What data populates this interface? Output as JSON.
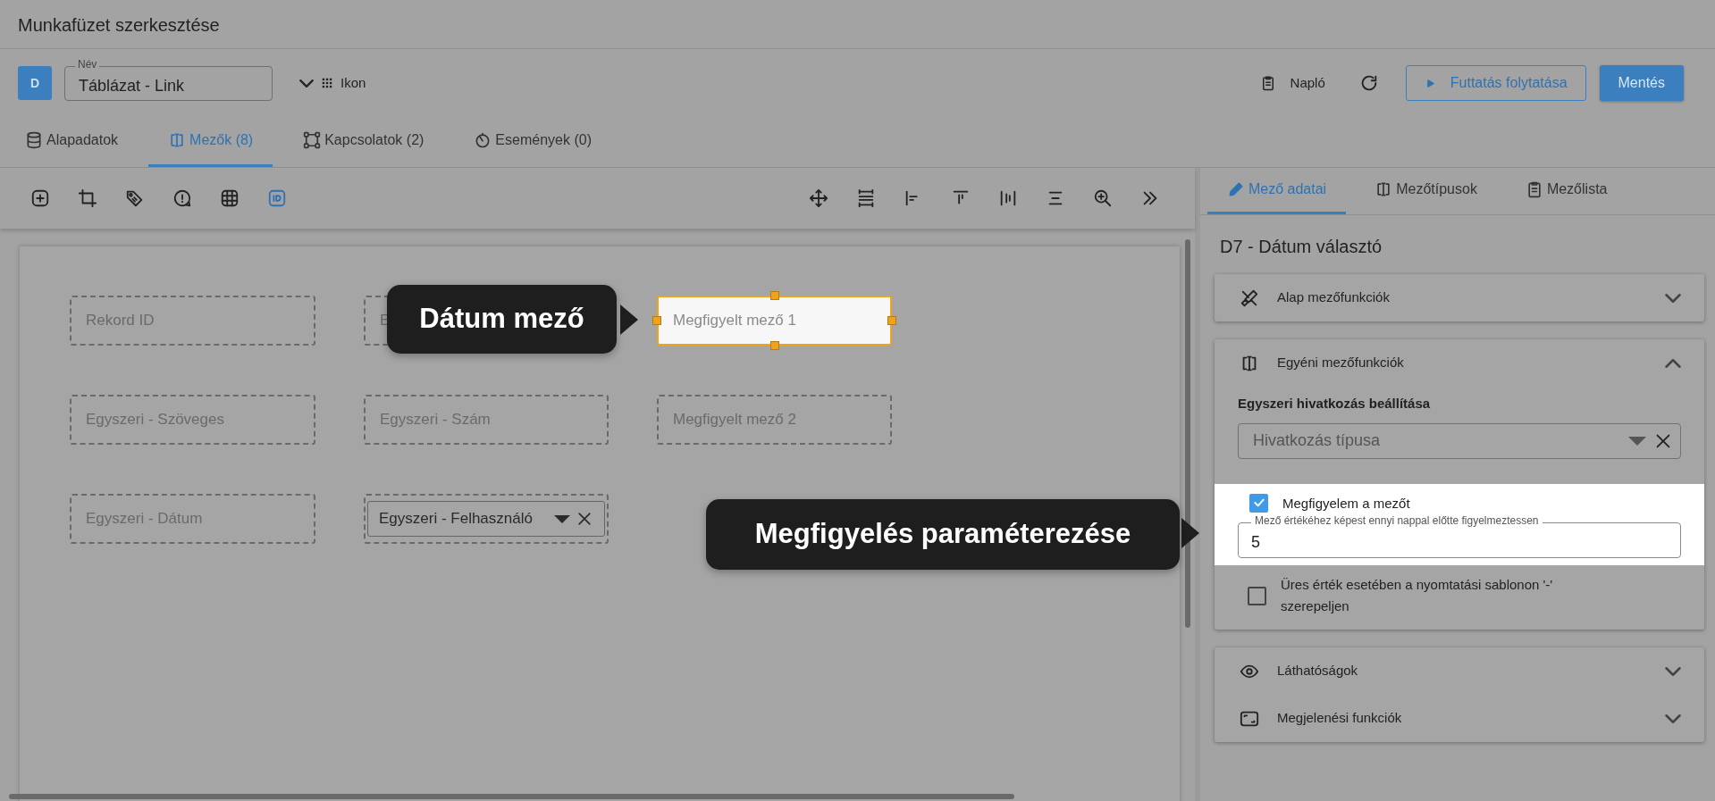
{
  "window": {
    "title": "Munkafüzet szerkesztése"
  },
  "header": {
    "avatar": "D",
    "name_field": {
      "label": "Név",
      "value": "Táblázat - Link"
    },
    "view_toggle": "Ikon",
    "log_button": "Napló",
    "run_button": "Futtatás folytatása",
    "save_button": "Mentés"
  },
  "tabs": [
    {
      "label": "Alapadatok",
      "selected": false
    },
    {
      "label": "Mezők (8)",
      "selected": true
    },
    {
      "label": "Kapcsolatok (2)",
      "selected": false
    },
    {
      "label": "Események (0)",
      "selected": false
    }
  ],
  "tools": [
    {
      "selected": false
    },
    {
      "selected": false
    },
    {
      "selected": false
    },
    {
      "selected": false
    },
    {
      "selected": false
    },
    {
      "selected": true
    }
  ],
  "side_tabs": [
    {
      "label": "Mező adatai",
      "selected": true
    },
    {
      "label": "Mezőtípusok",
      "selected": false
    },
    {
      "label": "Mezőlista",
      "selected": false
    }
  ],
  "canvas": {
    "fields": [
      {
        "kind": "text",
        "label": "Rekord ID",
        "selected": false
      },
      {
        "kind": "text",
        "label": "E",
        "selected": false
      },
      {
        "kind": "text",
        "label": "Megfigyelt mező 1",
        "selected": true
      },
      {
        "kind": "text",
        "label": "Egyszeri - Szöveges",
        "selected": false
      },
      {
        "kind": "text",
        "label": "Egyszeri - Szám",
        "selected": false
      },
      {
        "kind": "text",
        "label": "Megfigyelt mező 2",
        "selected": false
      },
      {
        "kind": "text",
        "label": "Egyszeri - Dátum",
        "selected": false
      },
      {
        "kind": "select",
        "label": "Egyszeri - Felhasználó",
        "selected": false
      }
    ]
  },
  "callouts": [
    {
      "text": "Dátum mező"
    },
    {
      "text": "Megfigyelés paraméterezése"
    }
  ],
  "panel": {
    "title": "D7 - Dátum választó",
    "groups": [
      {
        "sections": [
          {
            "title": "Alap mezőfunkciók",
            "expanded": false
          }
        ]
      },
      {
        "sections": [
          {
            "title": "Egyéni mezőfunkciók",
            "expanded": true,
            "subheading": "Egyszeri hivatkozás beállítása",
            "select": {
              "placeholder": "Hivatkozás típusa"
            },
            "watch": {
              "label": "Megfigyelem a mezőt",
              "checked": true,
              "days_field": {
                "label": "Mező értékéhez képest ennyi nappal előtte figyelmeztessen",
                "value": "5"
              }
            },
            "empty_dash": {
              "label": "Üres érték esetében a nyomtatási sablonon '-' szerepeljen",
              "checked": false
            }
          }
        ]
      },
      {
        "sections": [
          {
            "title": "Láthatóságok",
            "expanded": false
          },
          {
            "title": "Megjelenési funkciók",
            "expanded": false
          }
        ]
      }
    ]
  }
}
